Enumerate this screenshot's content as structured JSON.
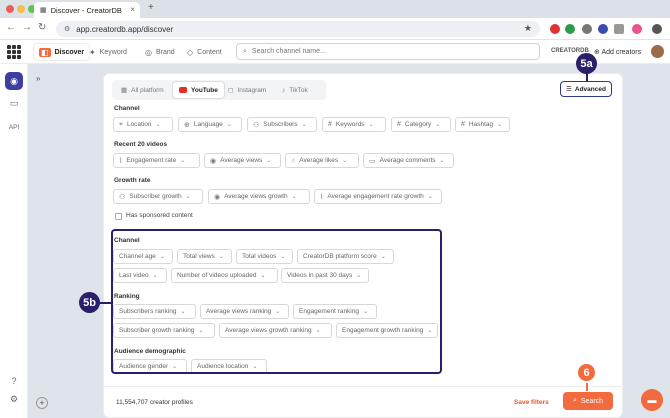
{
  "browser": {
    "tab_title": "Discover - CreatorDB",
    "tab_close": "×",
    "new_tab": "+",
    "url": "app.creatordb.app/discover"
  },
  "app": {
    "nav_tabs": [
      {
        "label": "Discover",
        "icon": "discover-icon"
      },
      {
        "label": "Keyword",
        "icon": "keyword-icon"
      },
      {
        "label": "Brand",
        "icon": "brand-icon"
      },
      {
        "label": "Content",
        "icon": "content-icon"
      }
    ],
    "search_placeholder": "Search channel name...",
    "corner_label": "CREATORDB",
    "add_creators": "Add creators"
  },
  "sidebar": {
    "api_label": "API",
    "add_label": "+"
  },
  "platform_tabs": [
    "All platform",
    "YouTube",
    "Instagram",
    "TikTok"
  ],
  "advanced_label": "Advanced",
  "sections": {
    "channel": {
      "title": "Channel",
      "chips": [
        "Location",
        "Language",
        "Subscribers",
        "Keywords",
        "Category",
        "Hashtag"
      ]
    },
    "recent": {
      "title": "Recent 20 videos",
      "chips": [
        "Engagement rate",
        "Average views",
        "Average likes",
        "Average comments"
      ]
    },
    "growth": {
      "title": "Growth rate",
      "chips": [
        "Subscriber growth",
        "Average views growth",
        "Average engagement rate growth"
      ]
    },
    "sponsored_label": "Has sponsored content",
    "adv_channel": {
      "title": "Channel",
      "row1": [
        "Channel age",
        "Total views",
        "Total videos",
        "CreatorDB platform score"
      ],
      "row2": [
        "Last video",
        "Number of videos uploaded",
        "Videos in past 30 days"
      ]
    },
    "ranking": {
      "title": "Ranking",
      "row1": [
        "Subscribers ranking",
        "Average views ranking",
        "Engagement ranking"
      ],
      "row2": [
        "Subscriber growth ranking",
        "Average views growth ranking",
        "Engagement growth ranking"
      ]
    },
    "audience": {
      "title": "Audience demographic",
      "chips": [
        "Audience gender",
        "Audience location"
      ]
    }
  },
  "footer": {
    "profiles": "11,554,707 creator profiles",
    "save_filters": "Save filters",
    "search_label": "Search"
  },
  "callouts": {
    "a": "5a",
    "b": "5b",
    "c": "6"
  },
  "colors": {
    "accent": "#f26a3d",
    "callout": "#2a1f6a",
    "sidebar_active": "#3b3f9e"
  }
}
